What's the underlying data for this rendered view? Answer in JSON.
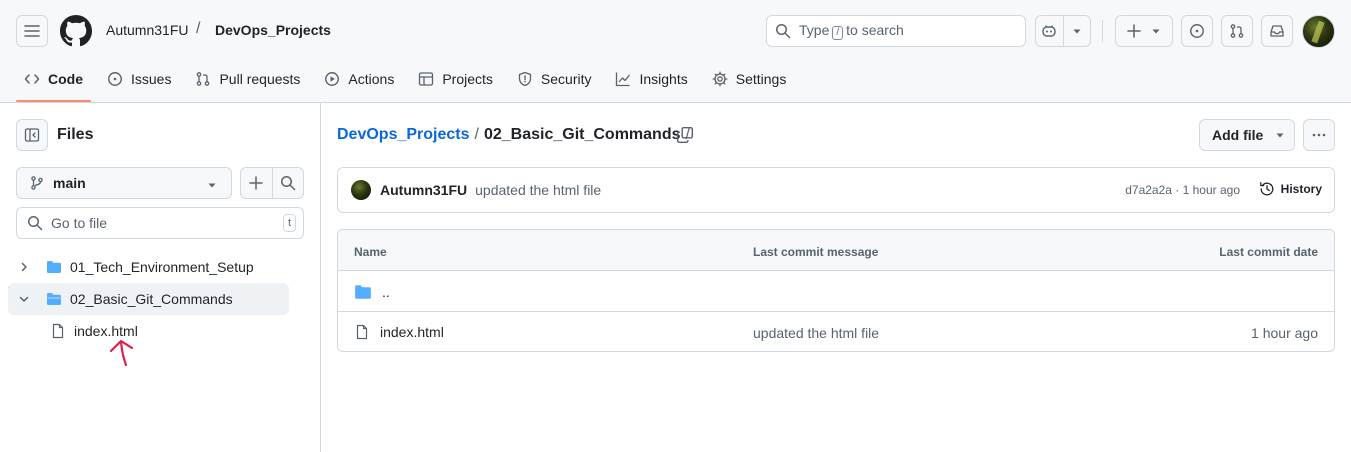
{
  "header": {
    "owner": "Autumn31FU",
    "separator": "/",
    "repo": "DevOps_Projects",
    "search": {
      "prefix": "Type",
      "key": "/",
      "suffix": "to search"
    }
  },
  "tabs": [
    {
      "label": "Code",
      "icon": "code-icon",
      "selected": true
    },
    {
      "label": "Issues",
      "icon": "issue-opened-icon"
    },
    {
      "label": "Pull requests",
      "icon": "git-pull-request-icon"
    },
    {
      "label": "Actions",
      "icon": "play-icon"
    },
    {
      "label": "Projects",
      "icon": "table-icon"
    },
    {
      "label": "Security",
      "icon": "shield-icon"
    },
    {
      "label": "Insights",
      "icon": "graph-icon"
    },
    {
      "label": "Settings",
      "icon": "gear-icon"
    }
  ],
  "sidebar": {
    "title": "Files",
    "branch": "main",
    "goto_placeholder": "Go to file",
    "goto_key": "t",
    "tree": [
      {
        "label": "01_Tech_Environment_Setup",
        "type": "folder",
        "expanded": false
      },
      {
        "label": "02_Basic_Git_Commands",
        "type": "folder",
        "expanded": true,
        "active": true
      },
      {
        "label": "index.html",
        "type": "file"
      }
    ]
  },
  "main": {
    "breadcrumb": {
      "root": "DevOps_Projects",
      "sep": "/",
      "current": "02_Basic_Git_Commands",
      "trail": "/"
    },
    "add_file_label": "Add file",
    "commit": {
      "author": "Autumn31FU",
      "message": "updated the html file",
      "meta": "d7a2a2a · 1 hour ago",
      "history_label": "History"
    },
    "table": {
      "headers": {
        "name": "Name",
        "message": "Last commit message",
        "date": "Last commit date"
      },
      "rows": [
        {
          "name": "..",
          "type": "folder",
          "message": "",
          "date": ""
        },
        {
          "name": "index.html",
          "type": "file",
          "message": "updated the html file",
          "date": "1 hour ago"
        }
      ]
    }
  },
  "colors": {
    "accent_link": "#0969da",
    "selected_tab_underline": "#fd8c73",
    "folder": "#54aeff",
    "annotation_arrow": "#e0204b"
  }
}
